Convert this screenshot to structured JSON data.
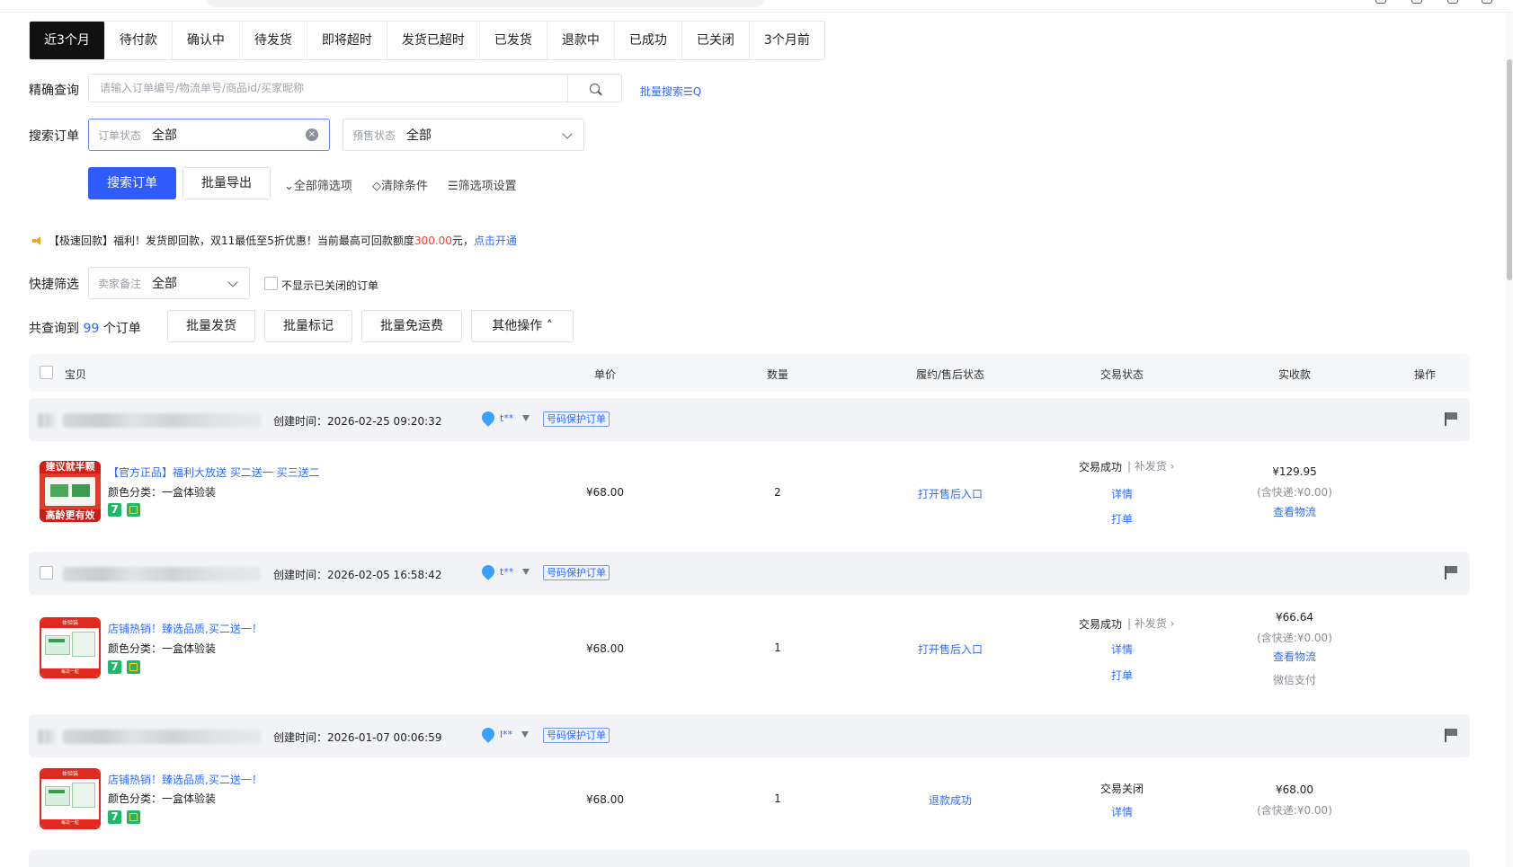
{
  "tabs": [
    "近3个月",
    "待付款",
    "确认中",
    "待发货",
    "即将超时",
    "发货已超时",
    "已发货",
    "退款中",
    "已成功",
    "已关闭",
    "3个月前"
  ],
  "search": {
    "label": "精确查询",
    "placeholder": "请输入订单编号/物流单号/商品id/买家昵称",
    "batch_link": "批量搜索☰Q"
  },
  "filters": {
    "label": "搜索订单",
    "order_status_label": "订单状态",
    "order_status_value": "全部",
    "presale_label": "预售状态",
    "presale_value": "全部"
  },
  "actions": {
    "search_btn": "搜索订单",
    "export_btn": "批量导出",
    "all_filters": "⌄全部筛选项",
    "clear": "◇清除条件",
    "settings": "☰筛选项设置"
  },
  "notice": {
    "prefix": "【极速回款】福利！发货即回款，双11最低至5折优惠！当前最高可回款额度",
    "amount": "300.00",
    "suffix": "元，",
    "link": "点击开通"
  },
  "quick": {
    "label": "快捷筛选",
    "remark_label": "卖家备注",
    "remark_value": "全部",
    "hide_closed": "不显示已关闭的订单"
  },
  "summary": {
    "prefix": "共查询到",
    "count": "99",
    "suffix": "个订单",
    "batch_ship": "批量发货",
    "batch_mark": "批量标记",
    "batch_free": "批量免运费",
    "other": "其他操作 ˄"
  },
  "table_headers": {
    "item": "宝贝",
    "price": "单价",
    "qty": "数量",
    "after_sale": "履约/售后状态",
    "trade_status": "交易状态",
    "received": "实收款",
    "ops": "操作"
  },
  "orders": [
    {
      "created": "创建时间：2026-02-25 09:20:32",
      "buyer": "t**",
      "tag": "号码保护订单",
      "title": "【官方正品】福利大放送 买二送一 买三送二",
      "spec": "颜色分类：一盒体验装",
      "thumb_top": "建议就半颗",
      "thumb_bottom": "高龄更有效",
      "price": "¥68.00",
      "qty": "2",
      "after_sale": "打开售后入口",
      "trade_status": "交易成功",
      "reship": "补发货 ›",
      "detail": "详情",
      "print": "打单",
      "received": "¥129.95",
      "shipping": "(含快递:¥0.00)",
      "logistics": "查看物流",
      "pay": ""
    },
    {
      "created": "创建时间：2026-02-05 16:58:42",
      "buyer": "t**",
      "tag": "号码保护订单",
      "title": "店铺热销！臻选品质,买二送一！",
      "spec": "颜色分类：一盒体验装",
      "thumb_top": "体验装",
      "thumb_bottom": "每次一粒",
      "price": "¥68.00",
      "qty": "1",
      "after_sale": "打开售后入口",
      "trade_status": "交易成功",
      "reship": "补发货 ›",
      "detail": "详情",
      "print": "打单",
      "received": "¥66.64",
      "shipping": "(含快递:¥0.00)",
      "logistics": "查看物流",
      "pay": "微信支付"
    },
    {
      "created": "创建时间：2026-01-07 00:06:59",
      "buyer": "l**",
      "tag": "号码保护订单",
      "title": "店铺热销！臻选品质,买二送一！",
      "spec": "颜色分类：一盒体验装",
      "thumb_top": "体验装",
      "thumb_bottom": "每次一粒",
      "price": "¥68.00",
      "qty": "1",
      "after_sale": "退款成功",
      "trade_status": "交易关闭",
      "reship": "",
      "detail": "详情",
      "print": "",
      "received": "¥68.00",
      "shipping": "(含快递:¥0.00)",
      "logistics": "",
      "pay": ""
    }
  ]
}
